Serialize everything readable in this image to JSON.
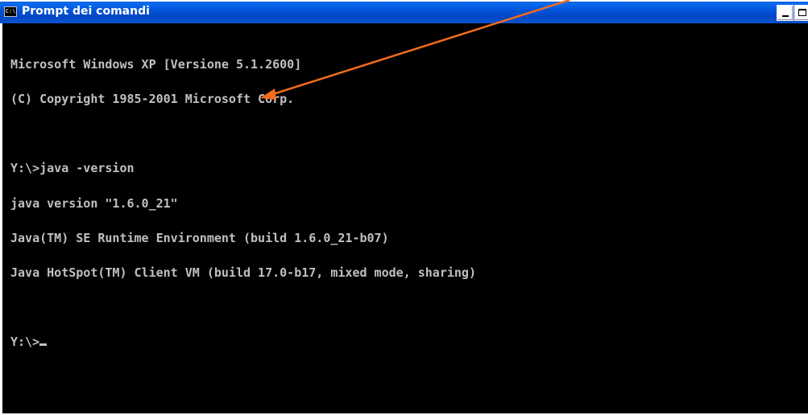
{
  "window": {
    "title": "Prompt dei comandi",
    "icon": "console-icon",
    "icon_glyph": "C:\\"
  },
  "controls": {
    "minimize_icon": "minimize-icon",
    "maximize_icon": "maximize-icon"
  },
  "console": {
    "lines": [
      "Microsoft Windows XP [Versione 5.1.2600]",
      "(C) Copyright 1985-2001 Microsoft Corp.",
      "",
      "Y:\\>java -version",
      "java version \"1.6.0_21\"",
      "Java(TM) SE Runtime Environment (build 1.6.0_21-b07)",
      "Java HotSpot(TM) Client VM (build 17.0-b17, mixed mode, sharing)",
      "",
      "Y:\\>"
    ]
  },
  "annotation": {
    "type": "arrow",
    "color": "#f26c1e"
  },
  "colors": {
    "titlebar": "#0353d8",
    "console_bg": "#000000",
    "console_text": "#c0c0c0"
  }
}
